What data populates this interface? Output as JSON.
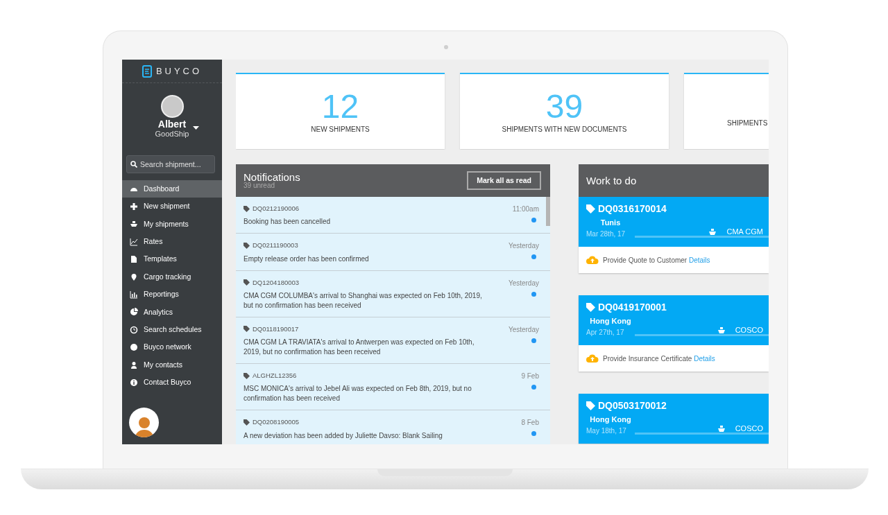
{
  "sidebar": {
    "logo": "BUYCO",
    "user": {
      "name": "Albert",
      "company": "GoodShip"
    },
    "search": {
      "placeholder": "Search shipment..."
    },
    "items": [
      {
        "label": "Dashboard",
        "selected": true
      },
      {
        "label": "New shipment",
        "selected": false
      },
      {
        "label": "My shipments",
        "selected": false
      },
      {
        "label": "Rates",
        "selected": false
      },
      {
        "label": "Templates",
        "selected": false
      },
      {
        "label": "Cargo tracking",
        "selected": false
      },
      {
        "label": "Reportings",
        "selected": false
      },
      {
        "label": "Analytics",
        "selected": false
      },
      {
        "label": "Search schedules",
        "selected": false
      },
      {
        "label": "Buyco network",
        "selected": false
      },
      {
        "label": "My contacts",
        "selected": false
      },
      {
        "label": "Contact Buyco",
        "selected": false
      }
    ]
  },
  "stats": [
    {
      "value": "12",
      "label": "NEW SHIPMENTS"
    },
    {
      "value": "39",
      "label": "SHIPMENTS WITH NEW DOCUMENTS"
    },
    {
      "label": "SHIPMENTS"
    }
  ],
  "notifications": {
    "title": "Notifications",
    "subtitle": "39 unread",
    "button": "Mark all as read",
    "items": [
      {
        "ref": "DQ0212190006",
        "time": "11:00am",
        "message": "Booking has been cancelled",
        "unread": true
      },
      {
        "ref": "DQ0211190003",
        "time": "Yesterday",
        "message": "Empty release order has been confirmed",
        "unread": true
      },
      {
        "ref": "DQ1204180003",
        "time": "Yesterday",
        "message": "CMA CGM COLUMBA's arrival to Shanghai was expected on Feb 10th, 2019, but no confirmation has been received",
        "unread": true
      },
      {
        "ref": "DQ0118190017",
        "time": "Yesterday",
        "message": "CMA CGM LA TRAVIATA's arrival to Antwerpen was expected on Feb 10th, 2019, but no confirmation has been received",
        "unread": true
      },
      {
        "ref": "ALGHZL12356",
        "time": "9 Feb",
        "message": "MSC MONICA's arrival to Jebel Ali was expected on Feb 8th, 2019, but no confirmation has been received",
        "unread": true
      },
      {
        "ref": "DQ0208190005",
        "time": "8 Feb",
        "message": "A new deviation has been added by Juliette Davso: Blank Sailing",
        "unread": true
      }
    ]
  },
  "work": {
    "title": "Work to do",
    "items": [
      {
        "ref": "DQ0316170014",
        "origin": "Tunis",
        "date": "Mar 28th, 17",
        "carrier": "CMA CGM",
        "task": "Provide Quote to Customer",
        "link": "Details"
      },
      {
        "ref": "DQ0419170001",
        "origin": "Hong Kong",
        "date": "Apr 27th, 17",
        "carrier": "COSCO",
        "task": "Provide Insurance Certificate",
        "link": "Details"
      },
      {
        "ref": "DQ0503170012",
        "origin": "Hong Kong",
        "date": "May 18th, 17",
        "carrier": "COSCO"
      }
    ]
  }
}
